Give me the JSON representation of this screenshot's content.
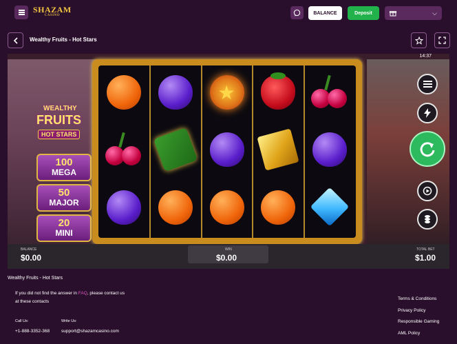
{
  "header": {
    "logo_text": "SHAZAM",
    "logo_sub": "CASINO",
    "balance_label": "BALANCE",
    "deposit_label": "Deposit",
    "colors": {
      "background": "#2a0f2c",
      "deposit": "#22b24c",
      "button": "#5a2a5e"
    }
  },
  "game_header": {
    "title": "Wealthy Fruits - Hot Stars"
  },
  "game": {
    "time": "14:37",
    "logo": {
      "line1": "WEALTHY",
      "line2": "FRUITS",
      "line3": "HOT STARS"
    },
    "jackpots": [
      {
        "amount": "100",
        "name": "MEGA"
      },
      {
        "amount": "50",
        "name": "MAJOR"
      },
      {
        "amount": "20",
        "name": "MINI"
      }
    ],
    "reels": [
      [
        "orange",
        "cherry",
        "plum"
      ],
      [
        "plum",
        "money",
        "orange"
      ],
      [
        "star",
        "plum",
        "orange"
      ],
      [
        "strawberry",
        "gold",
        "orange"
      ],
      [
        "cherry",
        "plum",
        "diamond"
      ]
    ],
    "bottom": {
      "balance_label": "BALANCE",
      "balance_value": "$0.00",
      "win_label": "WIN",
      "win_value": "$0.00",
      "total_bet_label": "TOTAL BET",
      "total_bet_value": "$1.00"
    }
  },
  "footer": {
    "title": "Wealthy Fruits - Hot Stars",
    "faq_before": "If you did not find the answer in ",
    "faq_link": "FAQ",
    "faq_after": ", please contact us at these contacts",
    "call_label": "Call Us:",
    "call_value": "+1-888-3352-368",
    "write_label": "Write Us:",
    "write_value": "support@shazamcasino.com",
    "links": [
      "Terms & Conditions",
      "Privacy Policy",
      "Responsible Gaming",
      "AML Policy"
    ]
  }
}
